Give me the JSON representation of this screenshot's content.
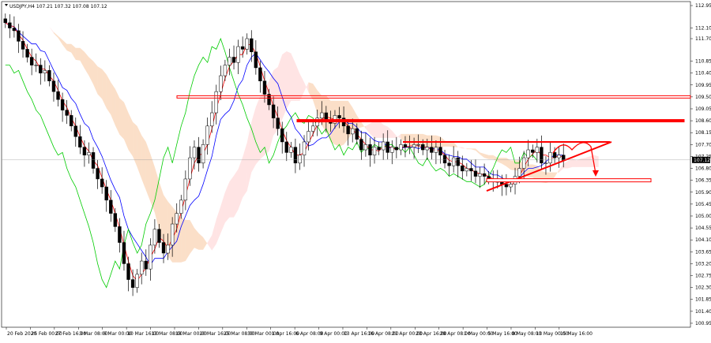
{
  "chart_data": {
    "type": "candlestick",
    "symbol_header": "USDJPY,H4  107.21 107.32 107.08 107.12",
    "price_marker": "107.12",
    "ylim": [
      100.8,
      113.1
    ],
    "y_ticks": [
      "112.95",
      "112.10",
      "111.70",
      "110.85",
      "110.40",
      "109.95",
      "109.50",
      "109.05",
      "108.60",
      "108.15",
      "107.70",
      "107.25",
      "106.80",
      "106.35",
      "105.90",
      "105.45",
      "105.00",
      "104.55",
      "104.10",
      "103.65",
      "103.20",
      "102.75",
      "102.30",
      "101.85",
      "101.40",
      "100.95"
    ],
    "x_ticks": [
      "20 Feb 2020",
      "25 Feb 00:00",
      "27 Feb 16:00",
      "3 Mar 08:00",
      "6 Mar 00:00",
      "10 Mar 16:00",
      "13 Mar 08:00",
      "18 Mar 00:00",
      "20 Mar 16:00",
      "25 Mar 08:00",
      "30 Mar 00:00",
      "1 Apr 16:00",
      "6 Apr 08:00",
      "9 Apr 00:00",
      "13 Apr 16:00",
      "16 Apr 08:00",
      "21 Apr 00:00",
      "23 Apr 16:00",
      "28 Apr 08:00",
      "1 May 00:00",
      "5 May 16:00",
      "8 May 08:00",
      "13 May 00:00",
      "15 May 16:00"
    ],
    "close": [
      112.3,
      112.1,
      112.0,
      111.6,
      111.3,
      111.0,
      110.7,
      110.7,
      110.4,
      110.5,
      110.1,
      109.7,
      109.4,
      109.0,
      108.8,
      108.4,
      108.0,
      107.6,
      107.3,
      107.4,
      106.8,
      106.4,
      106.1,
      105.6,
      105.1,
      104.6,
      104.0,
      103.2,
      102.6,
      102.3,
      102.8,
      103.3,
      103.0,
      103.9,
      104.5,
      104.0,
      103.6,
      103.9,
      104.7,
      105.1,
      105.6,
      106.4,
      107.2,
      107.6,
      107.0,
      107.7,
      108.4,
      108.9,
      109.7,
      110.3,
      110.7,
      111.0,
      110.8,
      111.4,
      111.3,
      111.7,
      111.2,
      110.6,
      110.1,
      109.6,
      109.2,
      108.7,
      108.3,
      107.8,
      107.4,
      107.6,
      107.0,
      107.3,
      107.8,
      108.2,
      108.4,
      108.7,
      108.9,
      108.6,
      108.5,
      108.8,
      108.7,
      108.4,
      108.1,
      108.3,
      107.9,
      107.5,
      107.7,
      107.3,
      107.6,
      107.5,
      107.8,
      107.4,
      107.6,
      107.5,
      107.7,
      107.6,
      107.6,
      107.7,
      107.7,
      107.5,
      107.6,
      107.4,
      107.6,
      107.3,
      107.0,
      106.9,
      107.2,
      106.9,
      106.7,
      106.8,
      106.7,
      106.5,
      106.6,
      106.5,
      106.4,
      106.3,
      106.3,
      106.2,
      106.1,
      106.2,
      106.5,
      106.8,
      107.2,
      107.5,
      107.4,
      107.6,
      107.0,
      107.0,
      107.4,
      107.2,
      107.3,
      107.1
    ],
    "overlays": {
      "resistance_levels": [
        109.5,
        108.6
      ],
      "upper_channel": 107.8,
      "support_level": 106.35,
      "support_zone_color": "#ff0000"
    },
    "colors": {
      "candle": "#000000",
      "tenkan": "#ff0000",
      "kijun": "#0000ff",
      "chikou": "#00cc00",
      "cloud": "#f4a460",
      "drawings": "#ff0000",
      "grid": "#c8c8c8"
    }
  }
}
